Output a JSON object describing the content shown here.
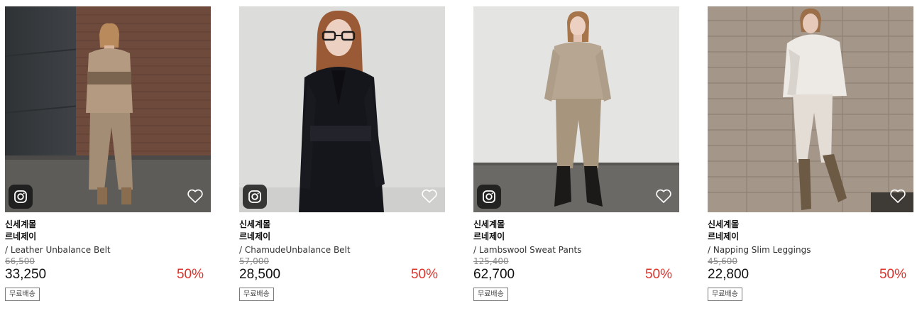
{
  "products": [
    {
      "brand_line1": "신세계몰",
      "brand_line2": "르네제이",
      "name": "/ Leather Unbalance Belt",
      "original_price": "66,500",
      "price": "33,250",
      "discount": "50%",
      "badge": "무료배송",
      "has_instagram_badge": true
    },
    {
      "brand_line1": "신세계몰",
      "brand_line2": "르네제이",
      "name": "/ ChamudeUnbalance Belt",
      "original_price": "57,000",
      "price": "28,500",
      "discount": "50%",
      "badge": "무료배송",
      "has_instagram_badge": true
    },
    {
      "brand_line1": "신세계몰",
      "brand_line2": "르네제이",
      "name": "/ Lambswool Sweat Pants",
      "original_price": "125,400",
      "price": "62,700",
      "discount": "50%",
      "badge": "무료배송",
      "has_instagram_badge": true
    },
    {
      "brand_line1": "신세계몰",
      "brand_line2": "르네제이",
      "name": "/ Napping Slim Leggings",
      "original_price": "45,600",
      "price": "22,800",
      "discount": "50%",
      "badge": "무료배송",
      "has_instagram_badge": false
    }
  ],
  "icons": {
    "instagram": "instagram-icon",
    "wishlist": "heart-outline-icon"
  },
  "colors": {
    "discount": "#e0322a",
    "price": "#111111",
    "original_price": "#888888"
  }
}
